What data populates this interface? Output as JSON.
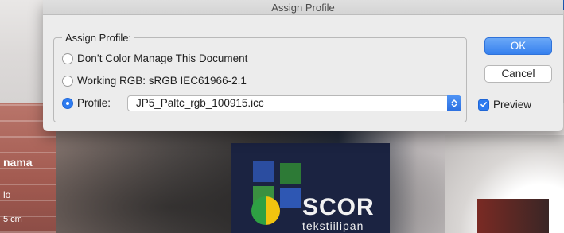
{
  "dialog": {
    "title": "Assign Profile",
    "group_label": "Assign Profile:",
    "options": [
      {
        "label": "Don’t Color Manage This Document",
        "selected": false
      },
      {
        "label": "Working RGB:  sRGB IEC61966-2.1",
        "selected": false
      },
      {
        "label": "Profile:",
        "selected": true
      }
    ],
    "profile_select": {
      "value": "JP5_Paltc_rgb_100915.icc"
    },
    "buttons": {
      "ok": "OK",
      "cancel": "Cancel"
    },
    "preview": {
      "label": "Preview",
      "checked": true
    }
  },
  "background": {
    "texts": [
      "nama",
      "lo",
      "5 cm",
      "SCOR",
      "tekstiilipan"
    ]
  },
  "colors": {
    "accent": "#2d7bf0",
    "dialog_bg": "#ececec"
  },
  "icons": {
    "stepper": "chevron-up-down-icon",
    "check": "checkmark-icon"
  }
}
